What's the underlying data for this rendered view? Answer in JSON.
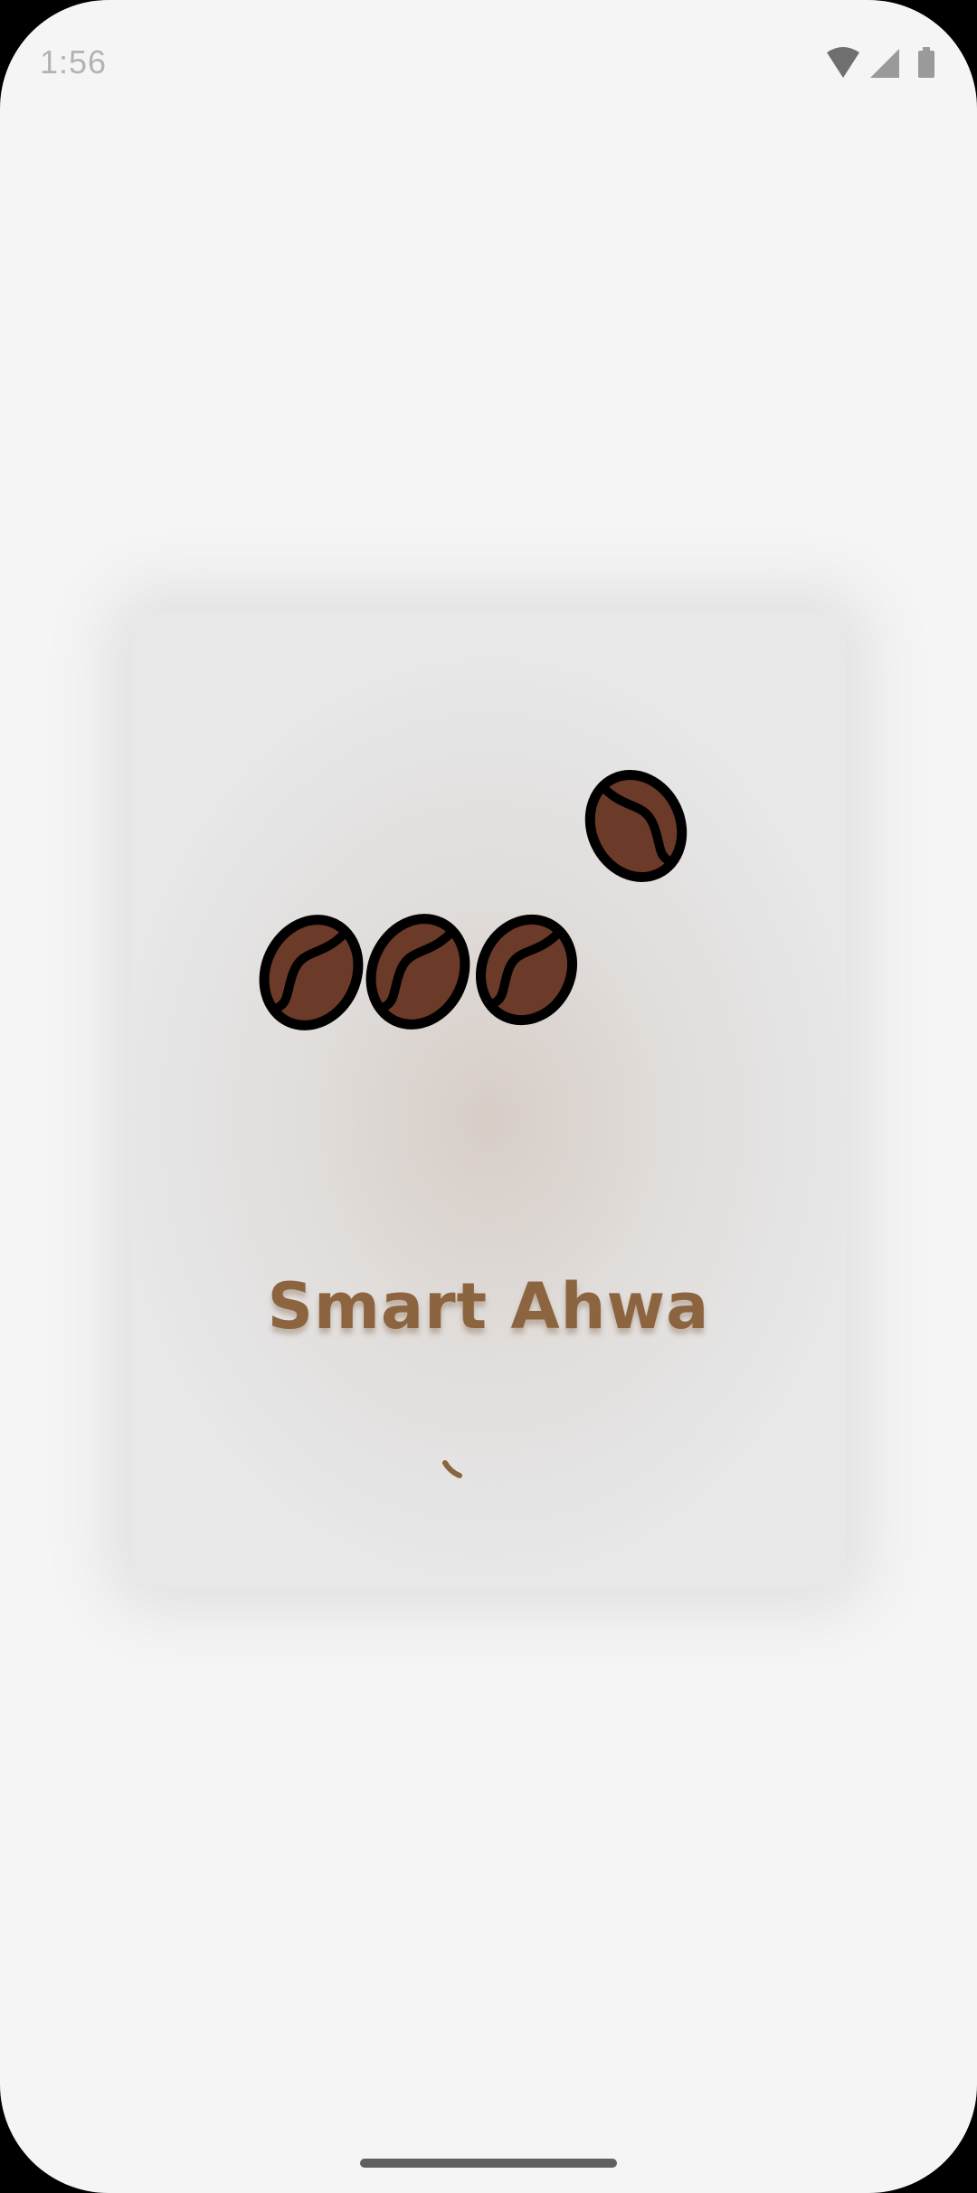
{
  "status_bar": {
    "time": "1:56",
    "icons": [
      "wifi-icon",
      "cellular-signal-icon",
      "battery-icon"
    ]
  },
  "splash": {
    "title": "Smart Ahwa",
    "title_color": "#8c6540",
    "bean_fill_color": "#6b3a28",
    "bean_outline_color": "#000000",
    "loading": true
  }
}
